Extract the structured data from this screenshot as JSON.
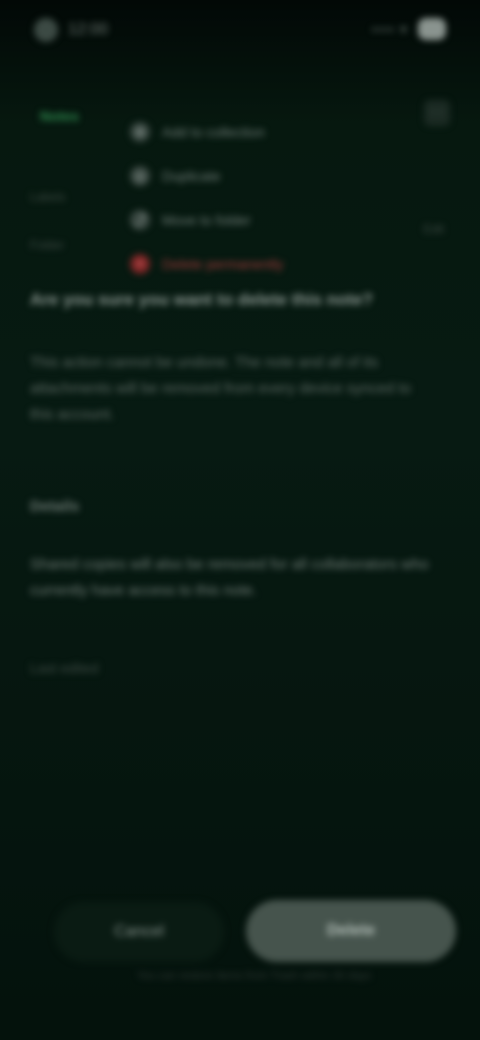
{
  "status_bar": {
    "time": "12:00",
    "signal": "•••• ▾",
    "battery_icon": "battery-icon"
  },
  "header": {
    "app_label": "Notes",
    "side_labels": [
      "Labels",
      "Folder"
    ],
    "right_label": "Edit",
    "corner_icon": "more-icon"
  },
  "menu": {
    "items": [
      {
        "icon": "⊕",
        "label": "Add to collection",
        "danger": false
      },
      {
        "icon": "◎",
        "label": "Duplicate",
        "danger": false
      },
      {
        "icon": "⤴",
        "label": "Move to folder",
        "danger": false
      },
      {
        "icon": "✕",
        "label": "Delete permanently",
        "danger": true
      }
    ]
  },
  "main": {
    "title": "Are you sure you want to delete this note?",
    "paragraph1": "This action cannot be undone. The note and all of its attachments will be removed from every device synced to this account.",
    "section_label": "Details",
    "paragraph2": "Shared copies will also be removed for all collaborators who currently have access to this note.",
    "footer_label": "Last edited"
  },
  "actions": {
    "cancel_label": "Cancel",
    "confirm_label": "Delete",
    "hint": "You can restore items from Trash within 30 days"
  }
}
